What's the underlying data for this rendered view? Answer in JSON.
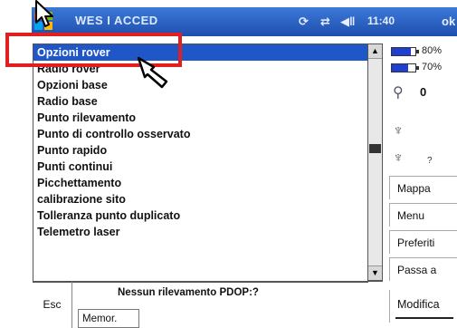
{
  "window": {
    "title": "WES I ACCED",
    "clock": "11:40"
  },
  "menu": {
    "items": [
      "Opzioni rover",
      "Radio rover",
      "Opzioni base",
      "Radio base",
      "Punto rilevamento",
      "Punto di controllo osservato",
      "Punto rapido",
      "Punti continui",
      "Picchettamento",
      "calibrazione sito",
      "Tolleranza punto duplicato",
      "Telemetro laser"
    ],
    "selected_index": 0
  },
  "status_panel": {
    "battery1": {
      "label": "80%",
      "level": 0.8
    },
    "battery2": {
      "label": "70%",
      "level": 0.7
    },
    "satellites": "0",
    "extra": "?"
  },
  "side_buttons": {
    "map": "Mappa",
    "menu": "Menu",
    "favorites": "Preferiti",
    "switch": "Passa a",
    "edit": "Modifica"
  },
  "bottom": {
    "esc": "Esc",
    "message": "Nessun rilevamento PDOP:?",
    "memo": "Memor."
  },
  "colors": {
    "titlebar": "#1e4fae",
    "selection": "#1f56c8",
    "highlight": "#e02020"
  },
  "icons": [
    "windows-flag-icon",
    "sync-icon",
    "signal-icon",
    "volume-icon",
    "ok-icon",
    "arrow-pointer-icon",
    "hand-pointer-icon",
    "satellite-icon",
    "tripod-icon",
    "radio-icon"
  ]
}
